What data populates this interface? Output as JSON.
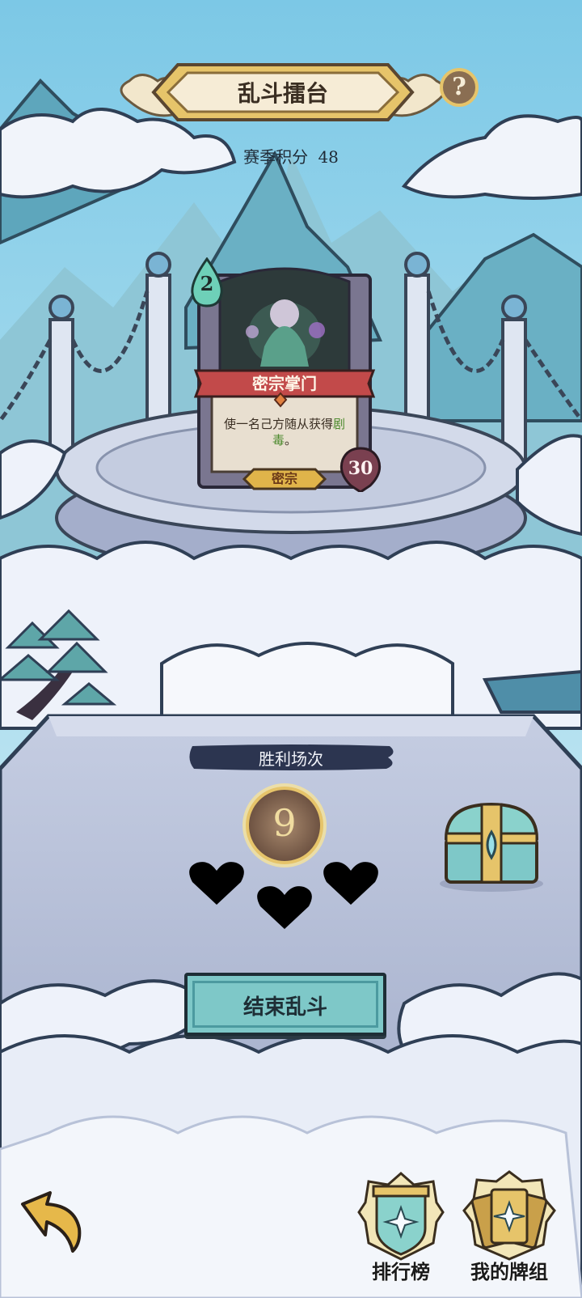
{
  "header": {
    "title": "乱斗擂台",
    "help_icon": "question-mark-icon",
    "season_score_label": "赛季积分",
    "season_score_value": "48"
  },
  "card": {
    "cost": "2",
    "name": "密宗掌门",
    "desc_prefix": "使一名己方随从获得",
    "desc_keyword": "剧毒",
    "desc_suffix": "。",
    "tag": "密宗",
    "health": "30",
    "colors": {
      "cost_gem": "#6ed0b8",
      "ribbon": "#c24a4a",
      "keyword": "#4d8a2e",
      "tag": "#e0b44a",
      "health": "#7a4050"
    }
  },
  "stats": {
    "wins_label": "胜利场次",
    "wins_value": "9",
    "lives": 3,
    "hearts_icon": "heart-icon",
    "chest_icon": "treasure-chest-icon"
  },
  "actions": {
    "end_brawl": "结束乱斗"
  },
  "bottom_nav": {
    "back_icon": "back-arrow-icon",
    "leaderboard": "排行榜",
    "leaderboard_icon": "leaderboard-shield-icon",
    "my_deck": "我的牌组",
    "my_deck_icon": "deck-cards-icon"
  },
  "colors": {
    "sky": "#8fd0e8",
    "mountain": "#6aaec0",
    "cloud": "#eef2fa",
    "panel": "#b8c2da",
    "button": "#7ec8c8",
    "button_border": "#2b4a52",
    "gold": "#e6c46a"
  }
}
